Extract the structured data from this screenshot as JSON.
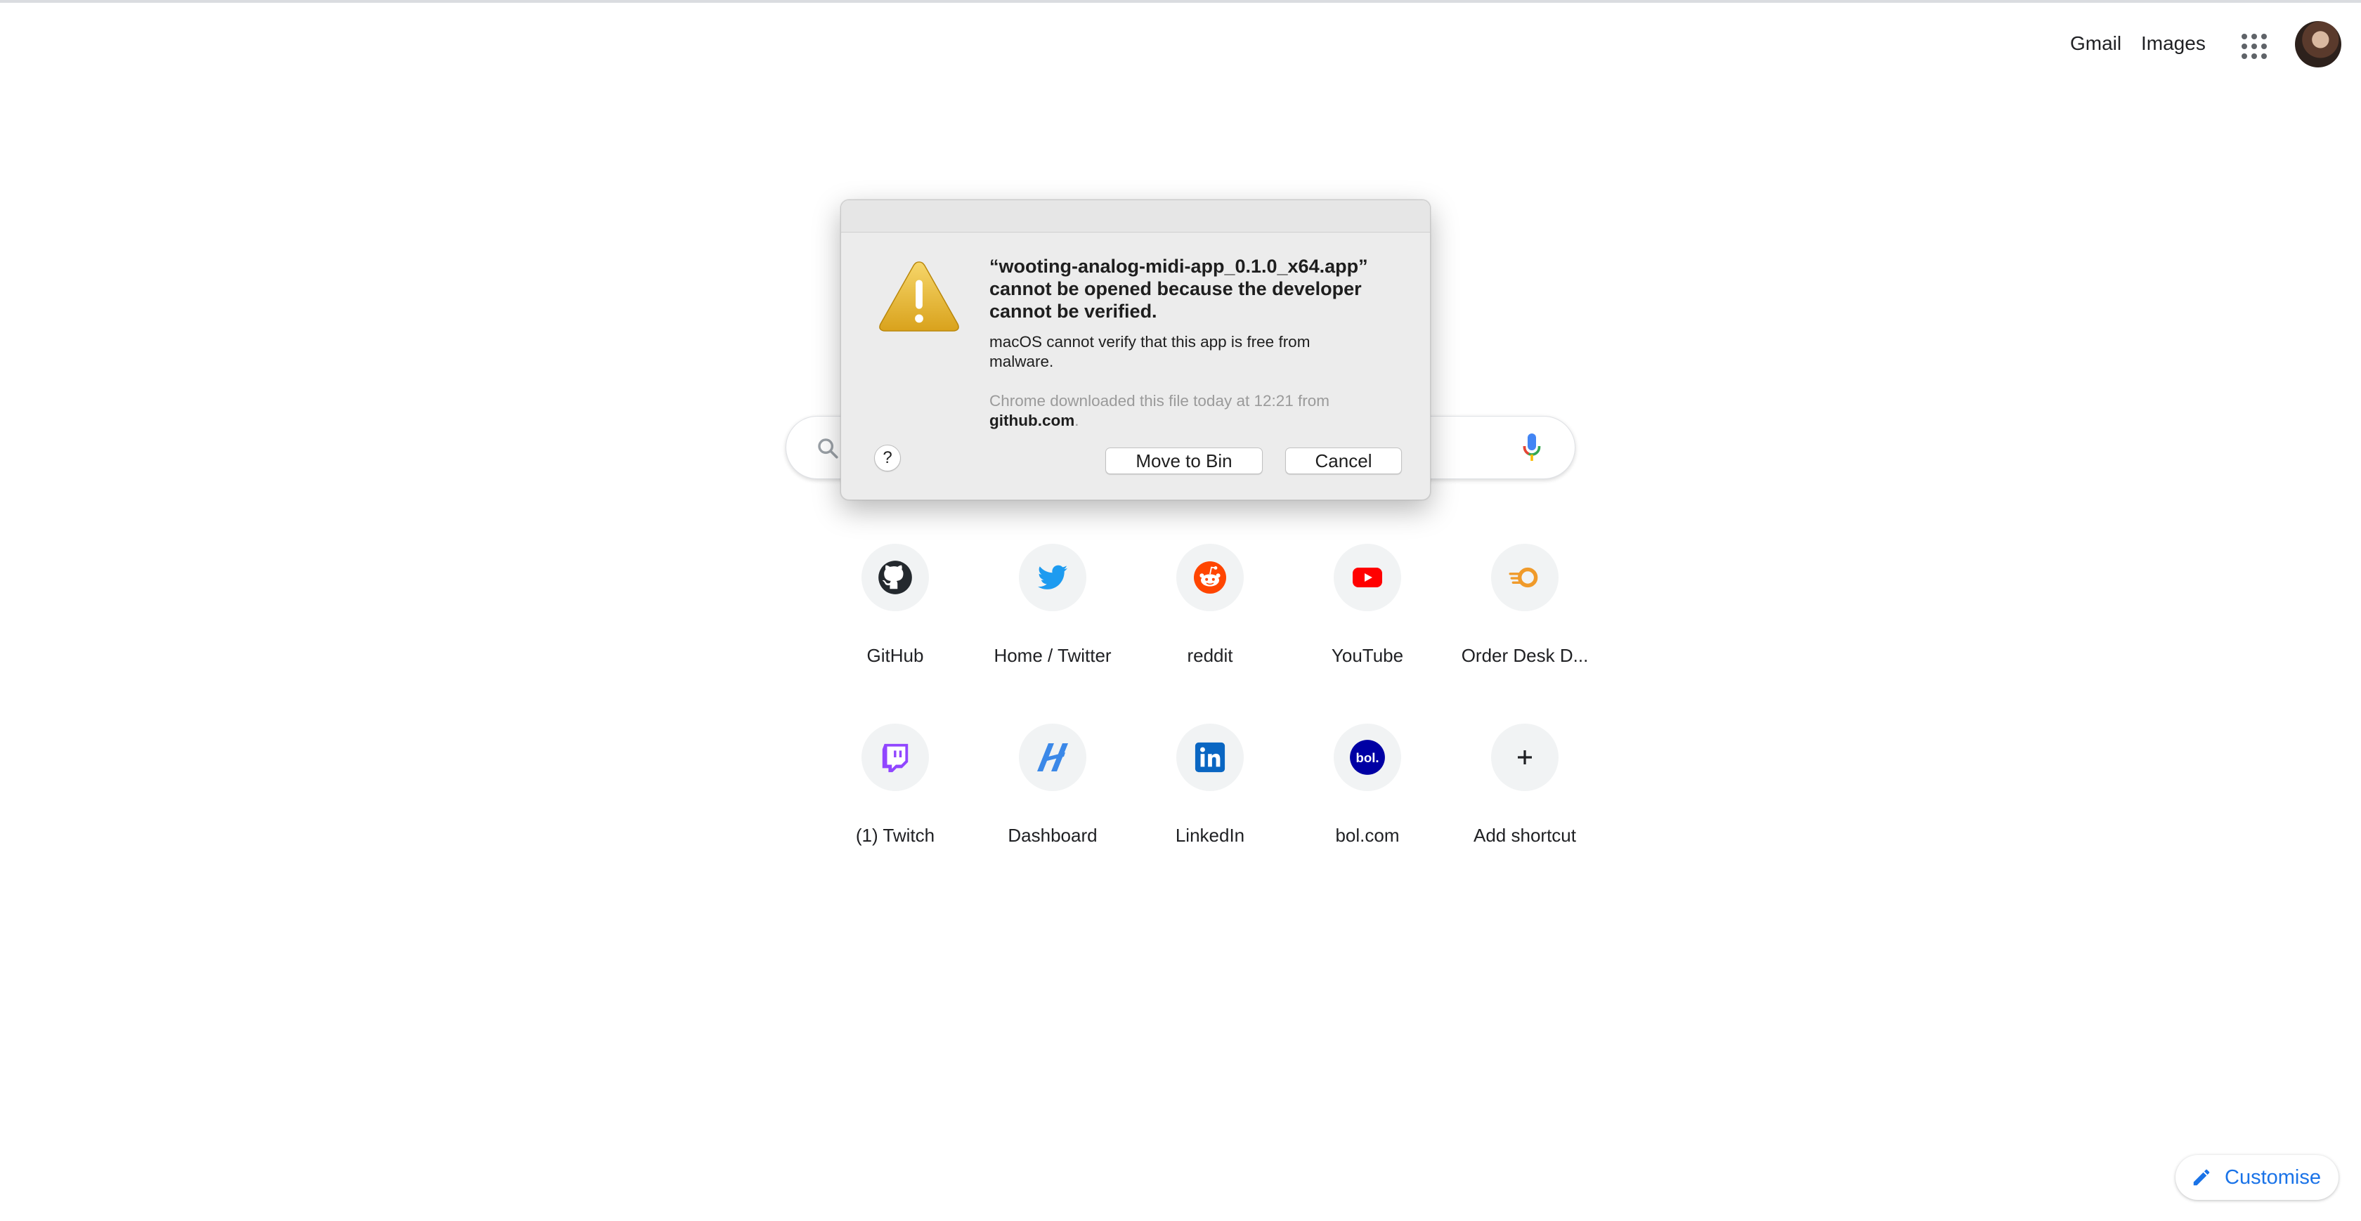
{
  "header": {
    "gmail_label": "Gmail",
    "images_label": "Images",
    "apps_icon": "apps-grid-icon",
    "avatar_icon": "account-avatar"
  },
  "search": {
    "placeholder": "",
    "search_icon": "search-icon",
    "mic_icon": "microphone-icon"
  },
  "shortcuts": [
    {
      "label": "GitHub",
      "icon": "github-icon"
    },
    {
      "label": "Home / Twitter",
      "icon": "twitter-icon"
    },
    {
      "label": "reddit",
      "icon": "reddit-icon"
    },
    {
      "label": "YouTube",
      "icon": "youtube-icon"
    },
    {
      "label": "Order Desk D...",
      "icon": "order-desk-icon"
    },
    {
      "label": "(1) Twitch",
      "icon": "twitch-icon"
    },
    {
      "label": "Dashboard",
      "icon": "dashboard-icon"
    },
    {
      "label": "LinkedIn",
      "icon": "linkedin-icon"
    },
    {
      "label": "bol.com",
      "icon": "bol-icon"
    },
    {
      "label": "Add shortcut",
      "icon": "plus-icon"
    }
  ],
  "customise": {
    "label": "Customise",
    "icon": "pencil-icon"
  },
  "dialog": {
    "title": "“wooting-analog-midi-app_0.1.0_x64.app” cannot be opened because the developer cannot be verified.",
    "message": "macOS cannot verify that this app is free from malware.",
    "source_text": "Chrome downloaded this file today at 12:21 from",
    "source_domain": "github.com",
    "source_period": ".",
    "help_label": "?",
    "move_to_bin_label": "Move to Bin",
    "cancel_label": "Cancel",
    "warning_icon": "warning-icon"
  },
  "colors": {
    "accent": "#1a73e8",
    "warning_yellow": "#e8b92e"
  }
}
